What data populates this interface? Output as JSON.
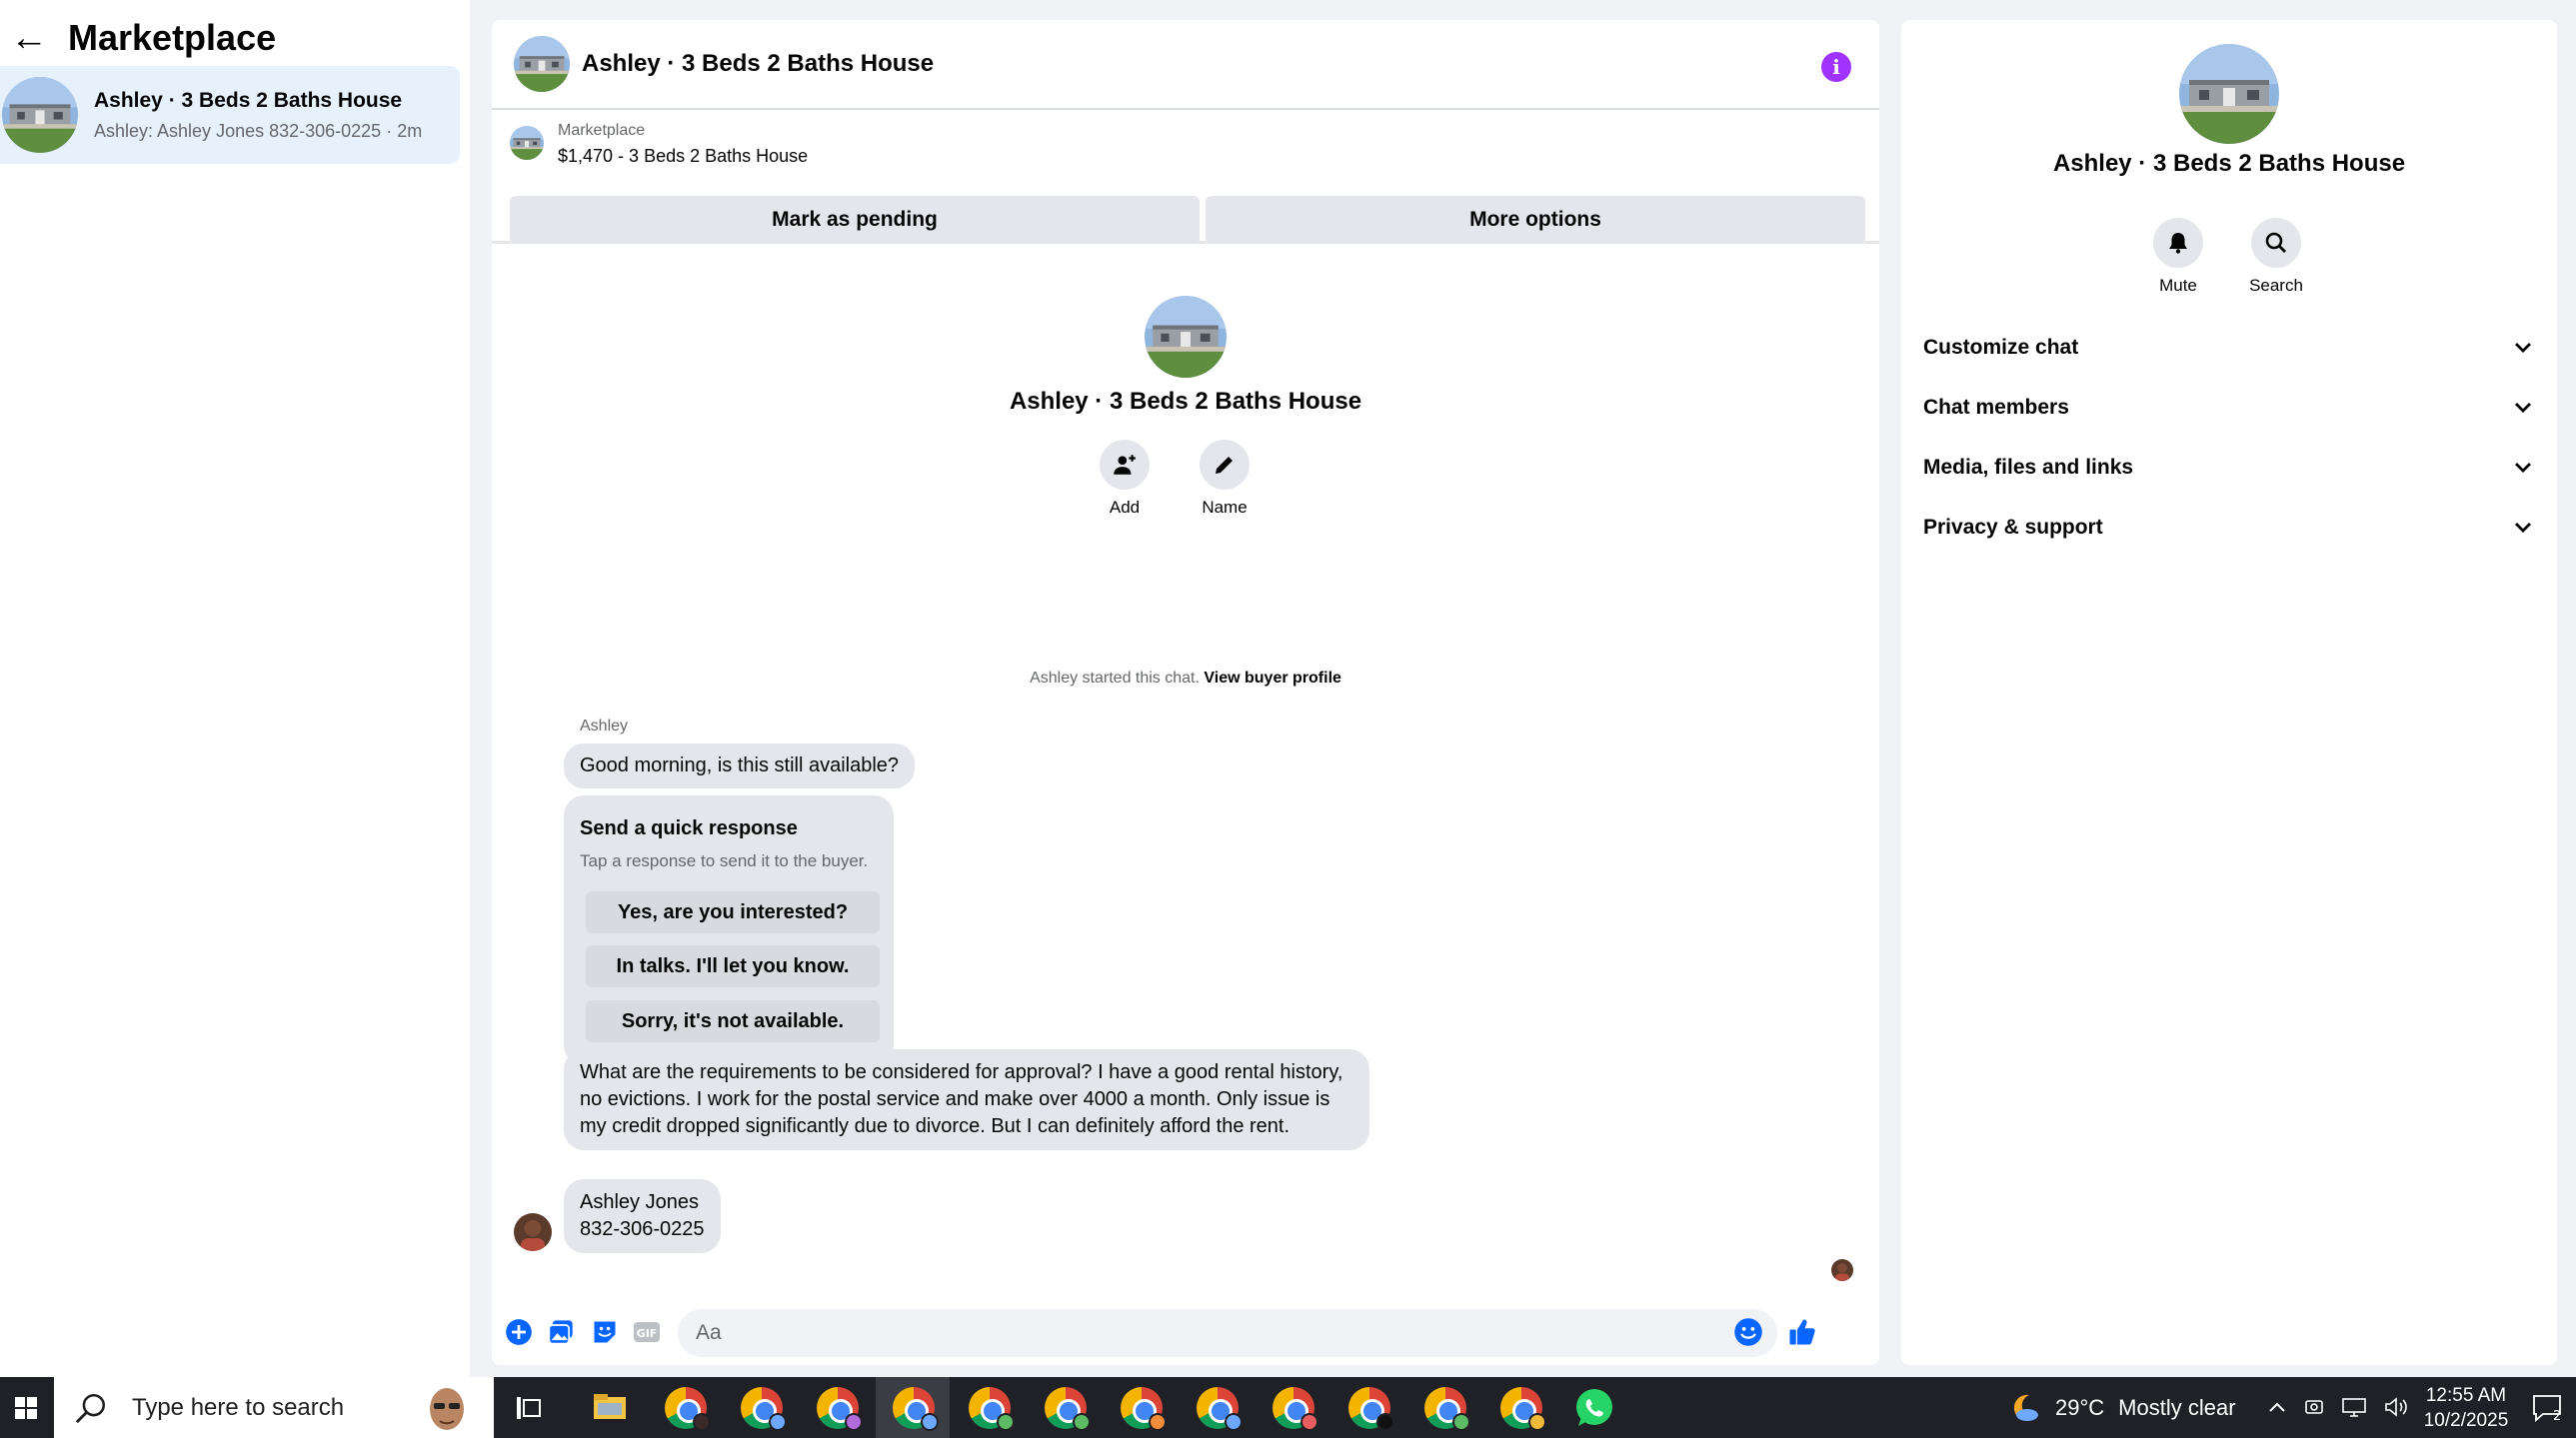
{
  "left": {
    "back_icon": "arrow-left-icon",
    "title": "Marketplace",
    "conversation": {
      "title": "Ashley · 3 Beds 2 Baths House",
      "preview": "Ashley: Ashley Jones 832-306-0225 · 2m"
    }
  },
  "chat": {
    "header_name": "Ashley · 3 Beds 2 Baths House",
    "info_icon": "i",
    "listing_source": "Marketplace",
    "listing_title": "$1,470 - 3 Beds 2 Baths House",
    "mark_pending": "Mark as pending",
    "more_options": "More options",
    "profile_name": "Ashley · 3 Beds 2 Baths House",
    "add_label": "Add",
    "name_label": "Name",
    "started_text": "Ashley started this chat.",
    "view_profile": "View buyer profile",
    "sender": "Ashley",
    "msg1": "Good morning, is this still available?",
    "quick_title": "Send a quick response",
    "quick_sub": "Tap a response to send it to the buyer.",
    "quick_options": [
      "Yes, are you interested?",
      "In talks. I'll let you know.",
      "Sorry, it's not available."
    ],
    "msg2": "What are the requirements to be considered for approval? I have a good rental history, no evictions. I work for the postal service and make over 4000 a month. Only issue is my credit dropped significantly due to divorce. But I can definitely afford the rent.",
    "msg3_line1": "Ashley Jones",
    "msg3_line2": "832-306-0225",
    "input_placeholder": "Aa"
  },
  "right": {
    "name": "Ashley · 3 Beds 2 Baths House",
    "mute_label": "Mute",
    "search_label": "Search",
    "sections": [
      "Customize chat",
      "Chat members",
      "Media, files and links",
      "Privacy & support"
    ]
  },
  "taskbar": {
    "search_placeholder": "Type here to search",
    "temperature": "29°C",
    "weather": "Mostly clear",
    "time": "12:55 AM",
    "date": "10/2/2025",
    "notification_count": "2"
  },
  "colors": {
    "accent": "#0866ff",
    "info": "#a033ff",
    "selected_bg": "#e7f1fc",
    "bubble_bg": "#e4e6eb"
  }
}
